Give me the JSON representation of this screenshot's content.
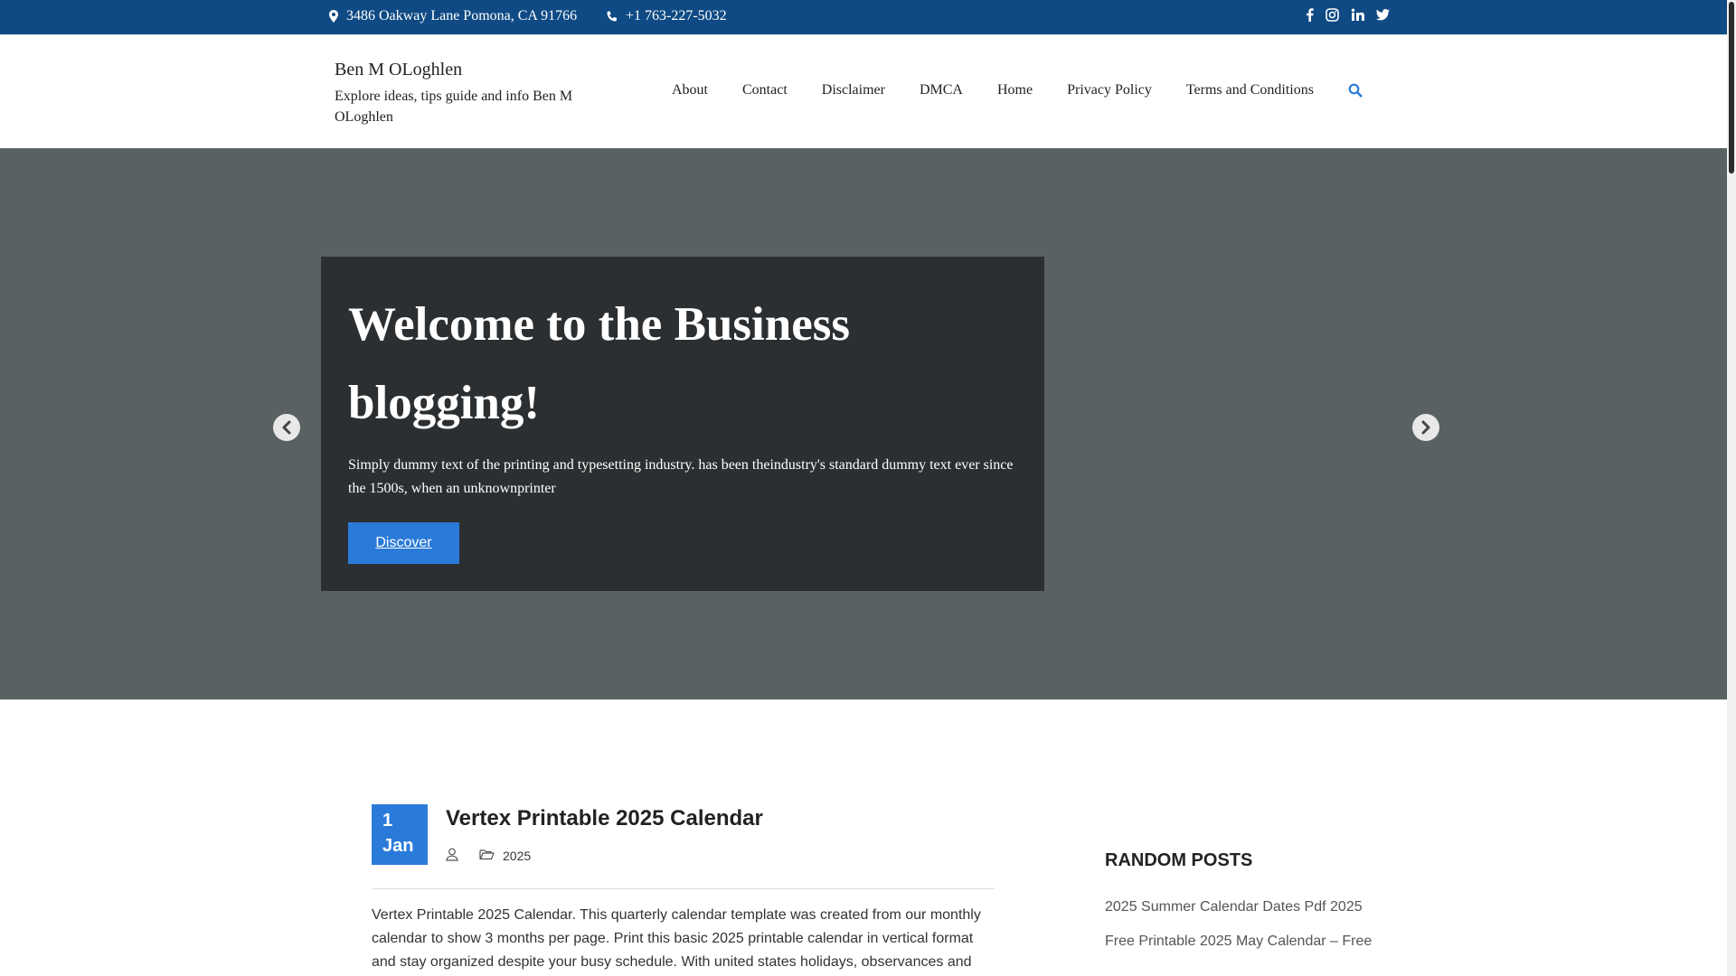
{
  "topbar": {
    "address": "3486 Oakway Lane Pomona, CA 91766",
    "phone": "+1 763-227-5032",
    "social_icons": [
      "facebook-icon",
      "instagram-icon",
      "linkedin-icon",
      "twitter-icon"
    ]
  },
  "header": {
    "site_title": "Ben M OLoghlen",
    "tagline": "Explore ideas, tips guide and info Ben M OLoghlen",
    "nav": [
      "About",
      "Contact",
      "Disclaimer",
      "DMCA",
      "Home",
      "Privacy Policy",
      "Terms and Conditions"
    ],
    "search_icon": "search-icon"
  },
  "hero": {
    "title": "Welcome to the Business blogging!",
    "text": "Simply dummy text of the printing and typesetting industry. has been theindustry's standard dummy text ever since the 1500s, when an unknownprinter",
    "button_label": "Discover",
    "prev_icon": "chevron-left-icon",
    "next_icon": "chevron-right-icon"
  },
  "post": {
    "day": "1",
    "month": "Jan",
    "title": "Vertex Printable 2025 Calendar",
    "category": "2025",
    "excerpt": "Vertex Printable 2025 Calendar. This quarterly calendar template was created from our monthly calendar to show 3 months per page. Print this basic 2025 printable calendar in vertical format and stay organized despite your busy schedule. With united states holidays, observances and"
  },
  "sidebar": {
    "title": "RANDOM POSTS",
    "items": [
      "2025 Summer Calendar Dates Pdf 2025",
      "Free Printable 2025 May Calendar – Free"
    ]
  },
  "colors": {
    "topbar": "#0f4a84",
    "accent": "#2a7bd9",
    "hero_bg": "#596163",
    "hero_box": "#2c2f31"
  }
}
